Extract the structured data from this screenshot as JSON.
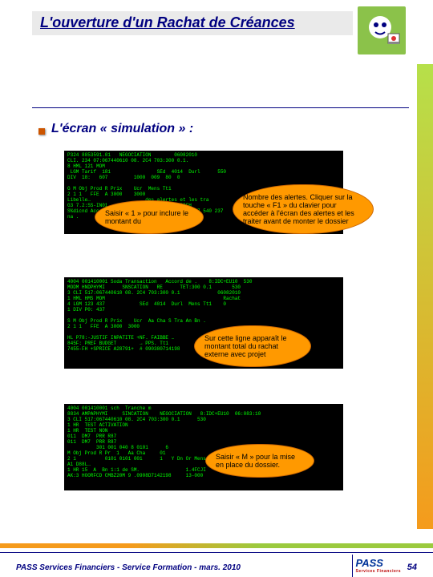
{
  "header": {
    "title": "L'ouverture d'un Rachat de Créances"
  },
  "section": {
    "subtitle": "L'écran « simulation » :"
  },
  "terminals": {
    "t1": "P324 8853591.01   NEGOCIATION        06082010\nCLI. 234 07:067440610 08. 2C4 703:300 0.1.\n8 HML 121 MOM\n LGM Tarif  181                SEd  4014  Durl      550\nDIV  18:   607         1000  009  80  0\n\nG M Obj Prod R Prix    Ucr  Mens Tt1\n2 1 1   FFE  A 3000    3000\nLibelle…                   des alertes et les tra\nG3 7.2:SS-IN01    15-1D0M  L4-CONF  12-ROCH\nS%dicnd Accord modification compte COMPTE 0107 540 237\nna .",
    "t2": "4004 001410001 Soda Transaction   Accord de .    8:IDC+EU10  530\nMODM HNDPHYMI      SNSCATION   RE      TET:300 0.1       530\n3 CLI 517:067440610 08. 2C4 703:300 0.1             06082010\n1 HML HMS MOM                                         Rachat\n4 LGM 123 437            SEd  4014  Durl  Mens Tt1    0\n1 DIV P0: 437\n\nS M Obj Prod R Prix    Ucr  Aa Cha S Tra An Bn .\n2 1 1   FFE  A 3000  3000\n\nHL P78:-JUSTIF INPATITE +NF. FAIBBE …         4014 AL Rachat\n845F: PREF BUDGET        → PPS. Tt1           0108\n7455-FH +SPRICE A28791+  # 090380714198       13-000",
    "t3": "4004 001410001 sch  Tranche m\n8834 AMPAPHYMI     SINCATION    NEGOCIATION   8:IDC+EU10  06:083:10\n3 CLI 517:067440610 08. 2C4 703:300 0.1      530\n1 HR  TEST ACTIVATION\n1 HR  TEST NON\n011  DM7  PRR R87\n011  DM7  PRR R87\n          301 001 040 8 0101      6\nM Obj Prod R Pr  1   Aa Cha     01\n2 1          0101 0101 001      1   Y Dn Or Mens Tt1\nA1 D88L…\n1 HR 15  A  Bn 1:1 de SM.                1.4FCJI\nAK:3 HOORFCD CMBZ20M 9 .0908D7142198     13-000"
  },
  "callouts": {
    "c1": "Saisir « 1 » pour inclure le montant du",
    "c2": "Nombre des alertes. Cliquer sur la touche « F1 » du clavier pour accéder à l'écran des alertes et les traiter avant de monter le dossier",
    "c3": "Sur cette ligne apparaît le montant total du rachat externe avec projet",
    "c4": "Saisir « M » pour la mise en place du dossier."
  },
  "footer": {
    "text": "PASS Services Financiers - Service Formation - mars. 2010",
    "logo": "PASS",
    "logo_sub": "Services Financiers",
    "page": "54"
  }
}
